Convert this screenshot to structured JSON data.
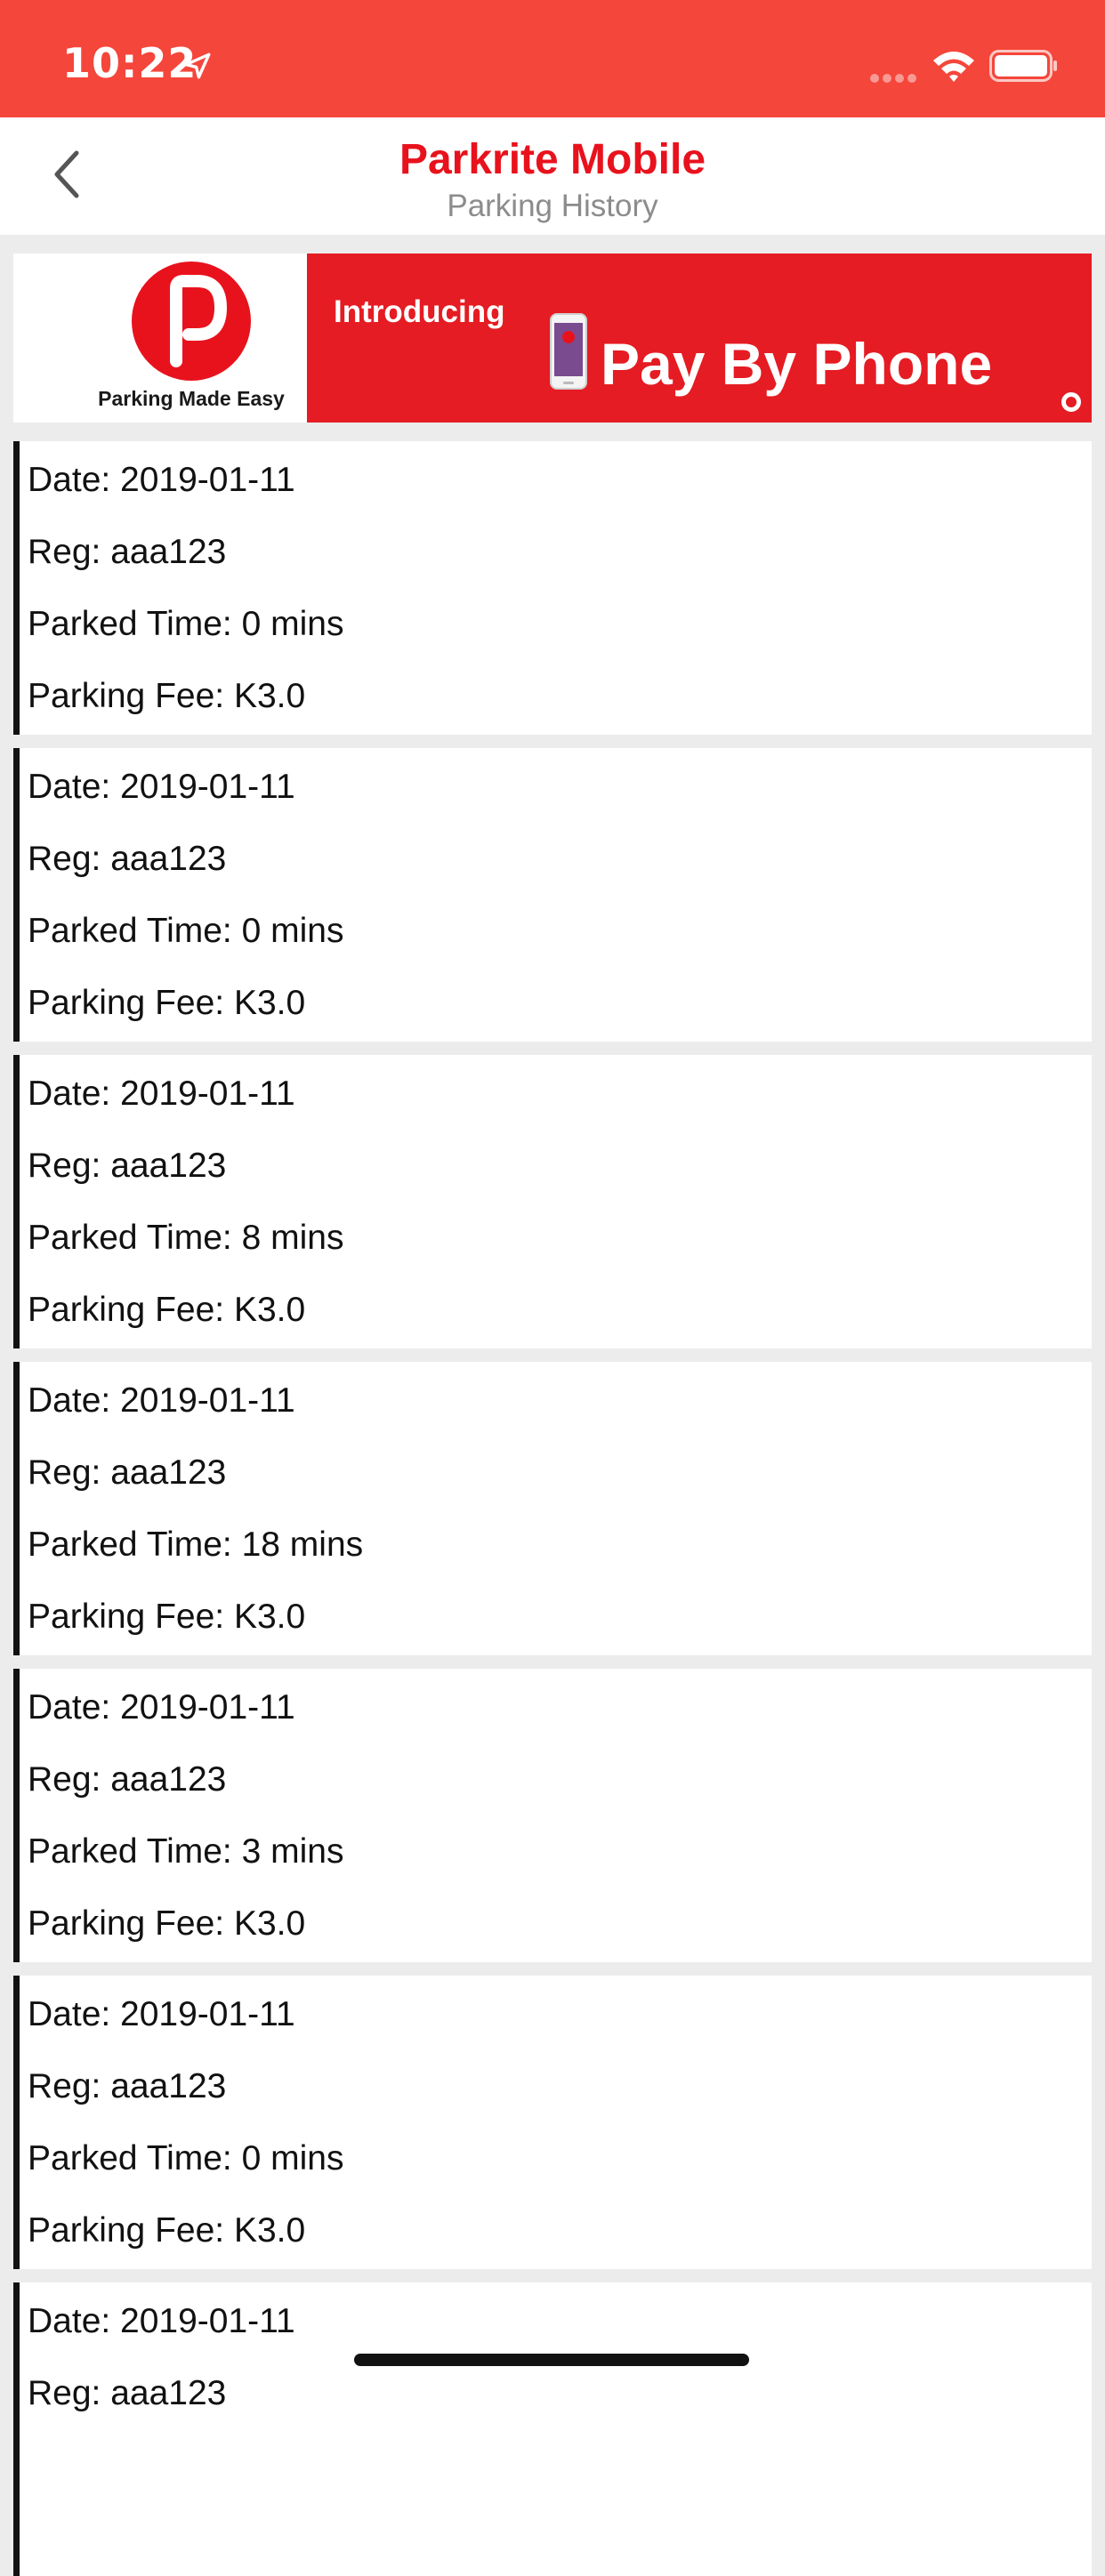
{
  "status_bar": {
    "time": "10:22",
    "icons": [
      "location-arrow-icon",
      "signal-icon",
      "wifi-icon",
      "battery-icon"
    ]
  },
  "nav": {
    "title": "Parkrite Mobile",
    "subtitle": "Parking History",
    "back_icon": "chevron-left-icon"
  },
  "banner": {
    "logo_letter": "P",
    "tagline": "Parking Made Easy",
    "intro": "Introducing",
    "headline": "Pay By Phone"
  },
  "history": [
    {
      "date": "Date: 2019-01-11",
      "reg": "Reg: aaa123",
      "time": "Parked Time: 0 mins",
      "fee": "Parking Fee: K3.0"
    },
    {
      "date": "Date: 2019-01-11",
      "reg": "Reg: aaa123",
      "time": "Parked Time: 0 mins",
      "fee": "Parking Fee: K3.0"
    },
    {
      "date": "Date: 2019-01-11",
      "reg": "Reg: aaa123",
      "time": "Parked Time: 8 mins",
      "fee": "Parking Fee: K3.0"
    },
    {
      "date": "Date: 2019-01-11",
      "reg": "Reg: aaa123",
      "time": "Parked Time: 18 mins",
      "fee": "Parking Fee: K3.0"
    },
    {
      "date": "Date: 2019-01-11",
      "reg": "Reg: aaa123",
      "time": "Parked Time: 3 mins",
      "fee": "Parking Fee: K3.0"
    },
    {
      "date": "Date: 2019-01-11",
      "reg": "Reg: aaa123",
      "time": "Parked Time: 0 mins",
      "fee": "Parking Fee: K3.0"
    },
    {
      "date": "Date: 2019-01-11",
      "reg": "Reg: aaa123",
      "time": "",
      "fee": ""
    }
  ],
  "colors": {
    "status_bar": "#f5463b",
    "brand_red": "#e8121d",
    "banner_red": "#e51c23",
    "subtitle_gray": "#8c8c8c",
    "list_background": "#ececec"
  }
}
